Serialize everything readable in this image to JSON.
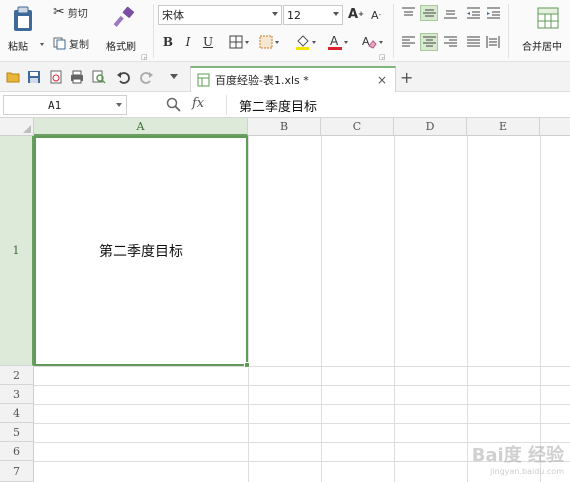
{
  "ribbon": {
    "paste_label": "粘贴",
    "cut_label": "剪切",
    "copy_label": "复制",
    "format_painter_label": "格式刷",
    "font_name": "宋体",
    "font_size": "12",
    "grow_font": "A",
    "shrink_font": "A",
    "bold": "B",
    "italic": "I",
    "underline": "U",
    "merge_center_label": "合并居中"
  },
  "tabs": [
    {
      "label": "百度经验-表1.xls *",
      "close": "×"
    }
  ],
  "new_tab": "+",
  "formula_bar": {
    "cell_ref": "A1",
    "fx": "fx",
    "content": "第二季度目标"
  },
  "grid": {
    "columns": [
      "A",
      "B",
      "C",
      "D",
      "E"
    ],
    "rows": [
      "1",
      "2",
      "3",
      "4",
      "5",
      "6",
      "7"
    ],
    "selected_column": "A",
    "selected_row": "1",
    "a1_value": "第二季度目标"
  },
  "watermark": {
    "brand": "Bai度 经验",
    "url": "jingyan.baidu.com"
  },
  "colors": {
    "accent": "#5f9a57",
    "selected_header_bg": "#dde9d9"
  }
}
